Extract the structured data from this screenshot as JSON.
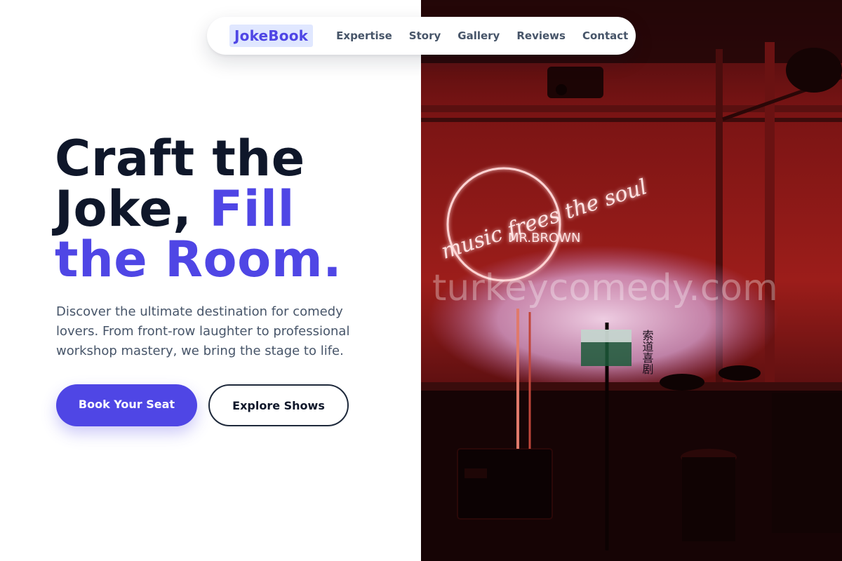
{
  "brand": {
    "name": "JokeBook"
  },
  "nav": {
    "links": [
      "Expertise",
      "Story",
      "Gallery",
      "Reviews",
      "Contact"
    ]
  },
  "hero": {
    "headline_part1": "Craft the",
    "headline_part2": "Joke, ",
    "headline_accent1": "Fill",
    "headline_accent2": "the Room.",
    "subtitle": "Discover the ultimate destination for comedy lovers. From front-row laughter to professional workshop mastery, we bring the stage to life.",
    "primary_button": "Book Your Seat",
    "secondary_button": "Explore Shows"
  },
  "photo": {
    "neon_script": "music frees the soul",
    "neon_name": "MR.BROWN",
    "watermark": "turkeycomedy.com",
    "wall_sign": "索道喜剧"
  },
  "colors": {
    "accent": "#4f46e5",
    "accent_light": "#e0e7ff",
    "heading": "#0f172a",
    "body_text": "#475569",
    "photo_red": "#8b1010"
  }
}
